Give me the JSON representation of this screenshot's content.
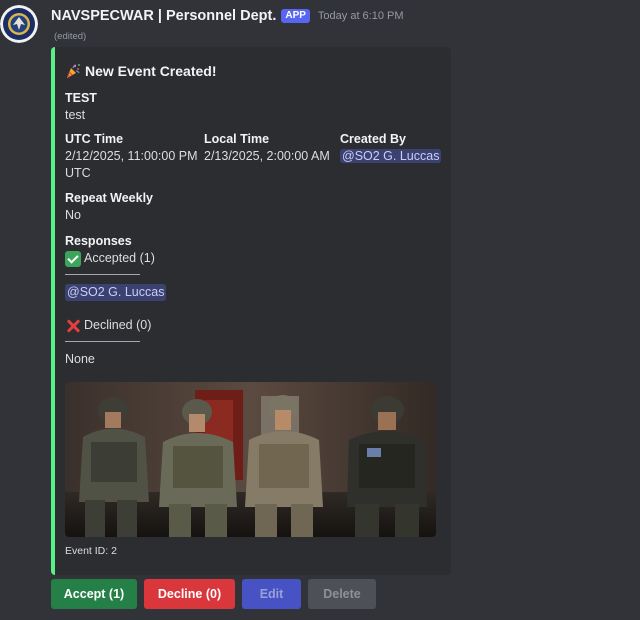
{
  "message": {
    "username": "NAVSPECWAR | Personnel Dept.",
    "badge": "APP",
    "timestamp": "Today at 6:10 PM",
    "edited": "(edited)"
  },
  "embed": {
    "accent_color": "#57f287",
    "title_emoji": "party-popper-icon",
    "title": "New Event Created!",
    "event_name": {
      "name": "TEST",
      "value": "test"
    },
    "utc_time": {
      "name": "UTC Time",
      "value_line1": "2/12/2025, 11:00:00 PM",
      "value_line2": "UTC"
    },
    "local_time": {
      "name": "Local Time",
      "value": "2/13/2025, 2:00:00 AM"
    },
    "created_by": {
      "name": "Created By",
      "value": "@SO2 G. Luccas"
    },
    "repeat_weekly": {
      "name": "Repeat Weekly",
      "value": "No"
    },
    "responses": {
      "name": "Responses",
      "accepted_label": "Accepted (1)",
      "divider": "——————",
      "accepted_users": [
        "@SO2 G. Luccas"
      ],
      "declined_label": "Declined (0)",
      "declined_users": "None"
    },
    "footer": "Event ID: 2"
  },
  "buttons": {
    "accept": "Accept (1)",
    "decline": "Decline (0)",
    "edit": "Edit",
    "delete": "Delete"
  }
}
